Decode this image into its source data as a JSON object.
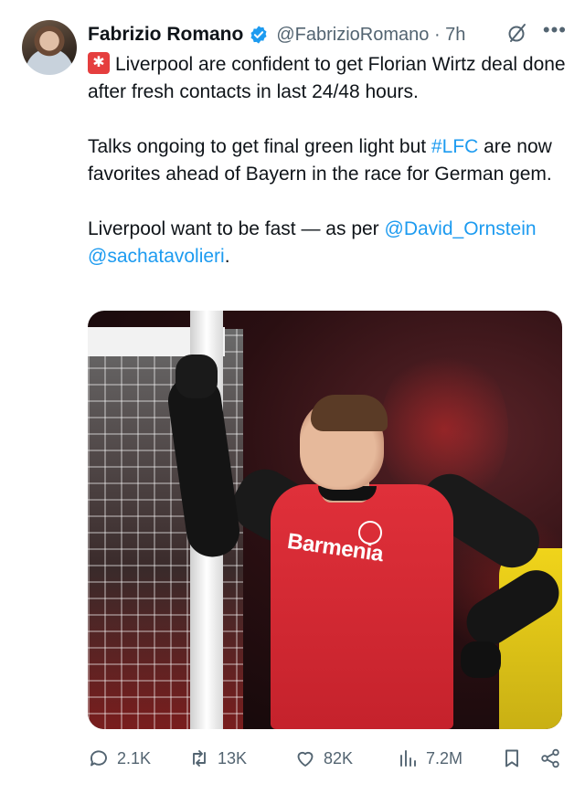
{
  "author": {
    "name": "Fabrizio Romano",
    "handle": "@FabrizioRomano",
    "separator": "·",
    "time": "7h"
  },
  "icons": {
    "verified": "verified-badge-icon",
    "grok": "grok-icon",
    "more": "more-icon",
    "siren": "siren-emoji-icon"
  },
  "colors": {
    "link": "#1d9bf0",
    "verified": "#1d9bf0",
    "text": "#0f1419",
    "muted": "#536471",
    "siren": "#e53e3e"
  },
  "tweet": {
    "line1": "Liverpool are confident to get Florian Wirtz deal done after fresh contacts in last 24/48 hours.",
    "line2_a": "Talks ongoing to get final green light but ",
    "line2_hashtag": "#LFC",
    "line2_b": " are now favorites ahead of Bayern in the race for German gem.",
    "line3_a": "Liverpool want to be fast — as per ",
    "line3_mention1": "@David_Ornstein",
    "line3_mention2": "@sachatavolieri",
    "line3_end": "."
  },
  "media": {
    "sponsor_text": "Barmenia"
  },
  "stats": {
    "replies": "2.1K",
    "reposts": "13K",
    "likes": "82K",
    "views": "7.2M"
  }
}
